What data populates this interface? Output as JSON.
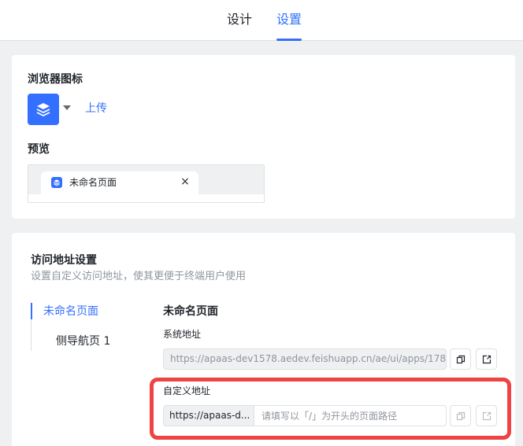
{
  "tabs": [
    {
      "label": "设计"
    },
    {
      "label": "设置"
    }
  ],
  "favicon_section": {
    "title": "浏览器图标",
    "upload_label": "上传",
    "icon": "layers-icon"
  },
  "preview_section": {
    "title": "预览",
    "tab_label": "未命名页面",
    "close_glyph": "×"
  },
  "access_section": {
    "title": "访问地址设置",
    "subtitle": "设置自定义访问地址，使其更便于终端用户使用",
    "nav_items": [
      {
        "label": "未命名页面"
      },
      {
        "label": "侧导航页 1"
      }
    ],
    "page_name": "未命名页面",
    "system_url_label": "系统地址",
    "system_url": "https://apaas-dev1578.aedev.feishuapp.cn/ae/ui/apps/178...",
    "custom_url_label": "自定义地址",
    "custom_url_prefix": "https://apaas-d...",
    "custom_url_placeholder": "请填写以「/」为开头的页面路径"
  },
  "colors": {
    "accent": "#3370ff",
    "highlight": "#ee4444",
    "background": "#eff0f1"
  }
}
